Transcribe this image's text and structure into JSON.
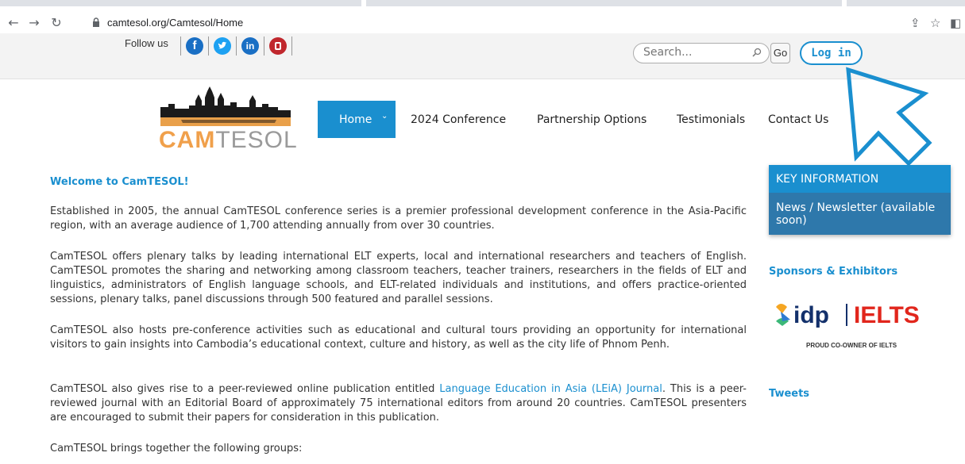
{
  "browser": {
    "url": "camtesol.org/Camtesol/Home"
  },
  "topbar": {
    "follow_label": "Follow us",
    "social": [
      {
        "name": "facebook-icon",
        "glyph": "f",
        "color": "#1a6fc4"
      },
      {
        "name": "twitter-icon",
        "glyph": "t",
        "color": "#1da1f2"
      },
      {
        "name": "linkedin-icon",
        "glyph": "in",
        "color": "#1a6fc4"
      },
      {
        "name": "youtube-icon",
        "glyph": "▯",
        "color": "#c0272d"
      }
    ],
    "search_placeholder": "Search...",
    "go_label": "Go",
    "login_label": "Log in"
  },
  "logo": {
    "cam": "CAM",
    "tesol": "TESOL"
  },
  "nav": {
    "home": "Home",
    "items": [
      "2024 Conference",
      "Partnership Options",
      "Testimonials",
      "Contact Us"
    ]
  },
  "main": {
    "welcome": "Welcome to CamTESOL!",
    "p1": "Established in 2005, the annual CamTESOL conference series is a premier professional development conference in the Asia-Pacific region, with an average audience of 1,700 attending annually from over 30 countries.",
    "p2": "CamTESOL offers plenary talks by leading international ELT experts, local and international researchers and teachers of English. CamTESOL promotes the sharing and networking among classroom teachers, teacher trainers, researchers in the fields of ELT and linguistics, administrators of English language schools, and ELT-related individuals and institutions, and offers practice-oriented sessions, plenary talks, panel discussions through 500 featured and parallel sessions.",
    "p3": "CamTESOL also hosts pre-conference activities such as educational and cultural tours providing an opportunity for international visitors to gain insights into Cambodia’s educational context, culture and history, as well as the city life of Phnom Penh.",
    "p4_before": "CamTESOL also gives rise to a peer-reviewed online publication entitled ",
    "p4_link": "Language Education in Asia (LEiA) Journal",
    "p4_after": ". This is a peer-reviewed journal with an Editorial Board of approximately 75 international editors from around 20 countries. CamTESOL presenters are encouraged to submit their papers for consideration in this publication.",
    "p5": "CamTESOL brings together the following groups:"
  },
  "sidebar": {
    "key_info_title": "KEY INFORMATION",
    "key_info_item": "News / Newsletter (available soon)",
    "sponsors_title": "Sponsors & Exhibitors",
    "idp_text": "idp",
    "ielts_text": "IELTS",
    "idp_caption": "PROUD CO-OWNER OF IELTS",
    "tweets_title": "Tweets"
  }
}
